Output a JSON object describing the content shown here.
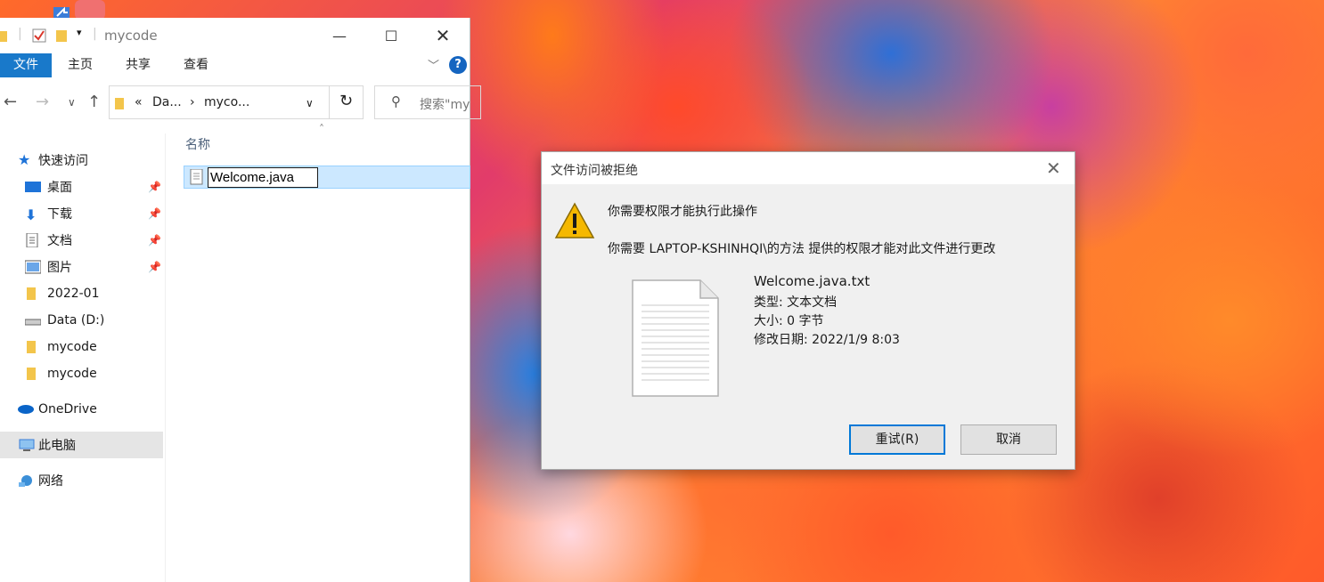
{
  "explorer": {
    "title": "mycode",
    "ribbon_tabs": [
      "文件",
      "主页",
      "共享",
      "查看"
    ],
    "help_label": "?",
    "address_segments": [
      "«",
      "Da...",
      "›",
      "myco..."
    ],
    "search_placeholder": "搜索\"my",
    "column_header": "名称",
    "nav_items": [
      {
        "label": "快速访问",
        "icon": "star-icon",
        "pinned": false
      },
      {
        "label": "桌面",
        "icon": "desktop-icon",
        "pinned": true
      },
      {
        "label": "下载",
        "icon": "download-icon",
        "pinned": true
      },
      {
        "label": "文档",
        "icon": "document-icon",
        "pinned": true
      },
      {
        "label": "图片",
        "icon": "pictures-icon",
        "pinned": true
      },
      {
        "label": "2022-01",
        "icon": "folder-icon",
        "pinned": false
      },
      {
        "label": "Data (D:)",
        "icon": "drive-icon",
        "pinned": false
      },
      {
        "label": "mycode",
        "icon": "folder-icon",
        "pinned": false
      },
      {
        "label": "mycode",
        "icon": "folder-icon",
        "pinned": false
      },
      {
        "label": "OneDrive",
        "icon": "onedrive-icon",
        "pinned": false
      },
      {
        "label": "此电脑",
        "icon": "computer-icon",
        "pinned": false
      },
      {
        "label": "网络",
        "icon": "network-icon",
        "pinned": false
      }
    ],
    "file": {
      "rename_value": "Welcome.java"
    }
  },
  "dialog": {
    "title": "文件访问被拒绝",
    "message_primary": "你需要权限才能执行此操作",
    "message_secondary": "你需要 LAPTOP-KSHINHQI\\的方法 提供的权限才能对此文件进行更改",
    "file_name": "Welcome.java.txt",
    "file_type": "类型: 文本文档",
    "file_size": "大小: 0 字节",
    "file_modified": "修改日期: 2022/1/9 8:03",
    "retry_label": "重试(R)",
    "cancel_label": "取消"
  },
  "colors": {
    "accent": "#1979ca",
    "selection": "#cce8ff",
    "warning": "#f5b800"
  }
}
